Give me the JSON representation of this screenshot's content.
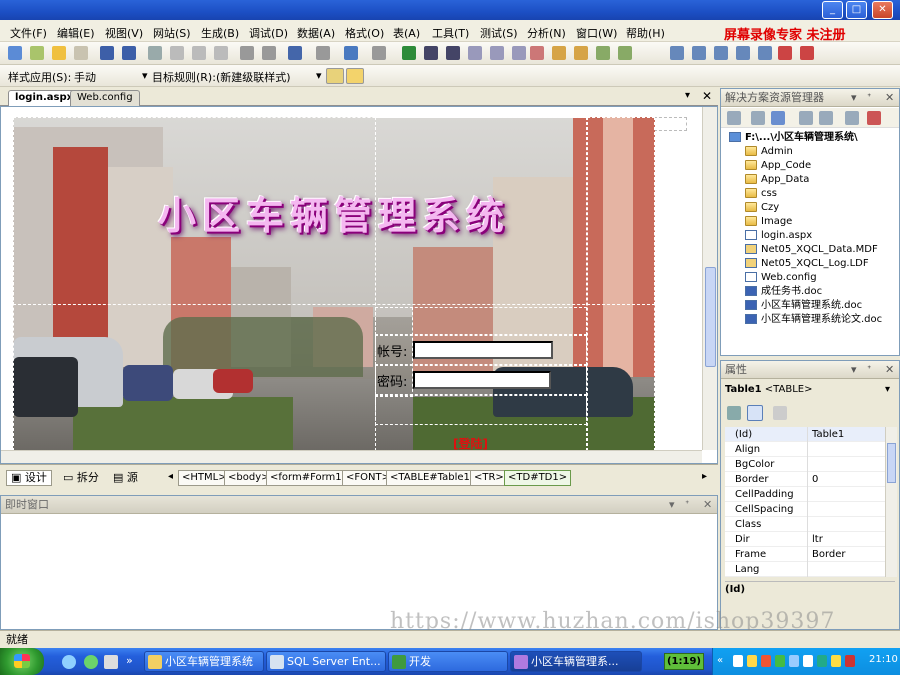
{
  "menu": [
    "文件(F)",
    "编辑(E)",
    "视图(V)",
    "网站(S)",
    "生成(B)",
    "调试(D)",
    "数据(A)",
    "格式(O)",
    "表(A)",
    "工具(T)",
    "测试(S)",
    "分析(N)",
    "窗口(W)",
    "帮助(H)"
  ],
  "watermark_top": "屏幕录像专家 未注册",
  "stylebar": {
    "style_label": "样式应用(S):",
    "style_value": "手动",
    "target_label": "目标规则(R):",
    "target_value": "(新建级联样式)"
  },
  "doc_tabs": [
    "login.aspx",
    "Web.config"
  ],
  "design": {
    "banner_title": "小区车辆管理系统",
    "account_label": "帐号:",
    "password_label": "密码:",
    "login_button": "[登陆]"
  },
  "view_buttons": [
    "设计",
    "拆分",
    "源"
  ],
  "tag_path": [
    "<HTML>",
    "<body>",
    "<form#Form1>",
    "<FONT>",
    "<TABLE#Table1>",
    "<TR>",
    "<TD#TD1>"
  ],
  "immediate_title": "即时窗口",
  "solution_explorer": {
    "title": "解决方案资源管理器",
    "root": "F:\\...\\小区车辆管理系统\\",
    "items": [
      {
        "name": "Admin",
        "type": "folder"
      },
      {
        "name": "App_Code",
        "type": "folder"
      },
      {
        "name": "App_Data",
        "type": "folder"
      },
      {
        "name": "css",
        "type": "folder"
      },
      {
        "name": "Czy",
        "type": "folder"
      },
      {
        "name": "Image",
        "type": "folder"
      },
      {
        "name": "login.aspx",
        "type": "file"
      },
      {
        "name": "Net05_XQCL_Data.MDF",
        "type": "file"
      },
      {
        "name": "Net05_XQCL_Log.LDF",
        "type": "file"
      },
      {
        "name": "Web.config",
        "type": "file"
      },
      {
        "name": "成任务书.doc",
        "type": "file"
      },
      {
        "name": "小区车辆管理系统.doc",
        "type": "file"
      },
      {
        "name": "小区车辆管理系统论文.doc",
        "type": "file"
      }
    ]
  },
  "properties": {
    "title": "属性",
    "object": "Table1",
    "object_type": "<TABLE>",
    "rows": [
      {
        "k": "(Id)",
        "v": "Table1"
      },
      {
        "k": "Align",
        "v": ""
      },
      {
        "k": "BgColor",
        "v": ""
      },
      {
        "k": "Border",
        "v": "0"
      },
      {
        "k": "CellPadding",
        "v": ""
      },
      {
        "k": "CellSpacing",
        "v": ""
      },
      {
        "k": "Class",
        "v": ""
      },
      {
        "k": "Dir",
        "v": "ltr"
      },
      {
        "k": "Frame",
        "v": "Border"
      },
      {
        "k": "Lang",
        "v": ""
      }
    ],
    "description": "(Id)"
  },
  "status": "就绪",
  "url_watermark": "https://www.huzhan.com/ishop39397",
  "taskbar": {
    "tasks": [
      "小区车辆管理系统",
      "SQL Server Ent...",
      "开发",
      "小区车辆管理系..."
    ],
    "recorder": "(1:19)",
    "clock": "21:10"
  }
}
